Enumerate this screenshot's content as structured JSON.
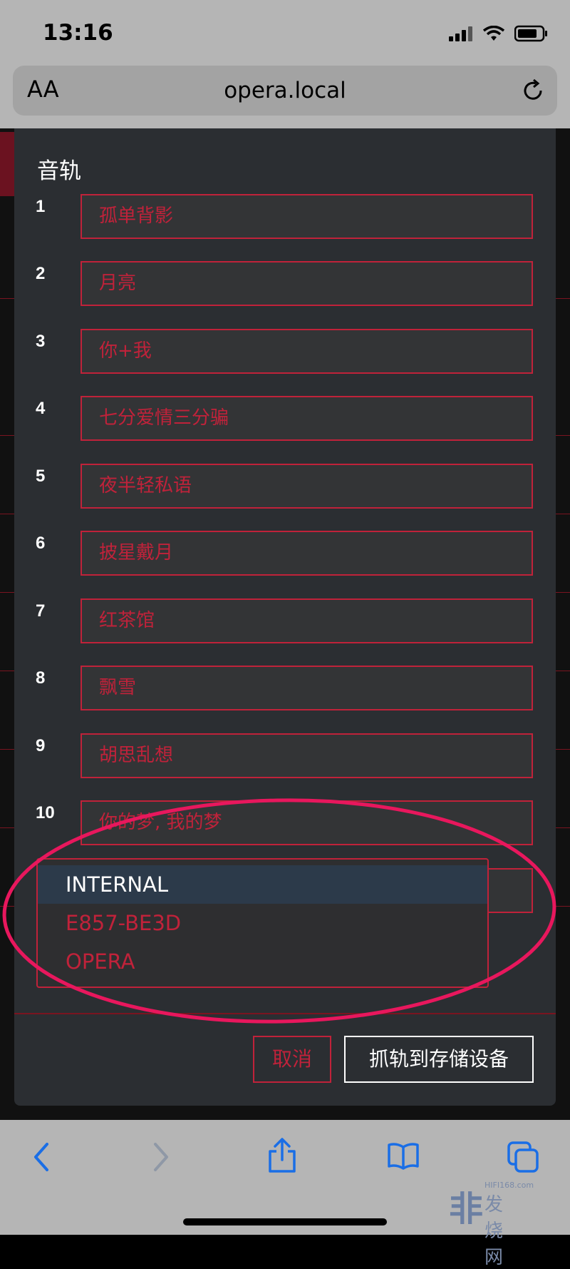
{
  "status_bar": {
    "time": "13:16"
  },
  "browser": {
    "text_size_label": "AA",
    "url": "opera.local"
  },
  "modal": {
    "title": "音轨",
    "tracks": [
      {
        "number": "1",
        "title": "孤单背影"
      },
      {
        "number": "2",
        "title": "月亮"
      },
      {
        "number": "3",
        "title": "你+我"
      },
      {
        "number": "4",
        "title": "七分爱情三分骗"
      },
      {
        "number": "5",
        "title": "夜半轻私语"
      },
      {
        "number": "6",
        "title": "披星戴月"
      },
      {
        "number": "7",
        "title": "红茶馆"
      },
      {
        "number": "8",
        "title": "飘雪"
      },
      {
        "number": "9",
        "title": "胡思乱想"
      },
      {
        "number": "10",
        "title": "你的梦, 我的梦"
      }
    ],
    "storage_dropdown": {
      "options": [
        "INTERNAL",
        "E857-BE3D",
        "OPERA"
      ],
      "selected": "INTERNAL"
    },
    "cancel_label": "取消",
    "rip_label": "抓轨到存储设备"
  },
  "watermark": {
    "site": "HIFI168.com",
    "text": "发烧网"
  },
  "colors": {
    "accent": "#c0223a",
    "modal_bg": "#2b2e32",
    "highlight": "#e8175d",
    "chrome": "#b5b5b5",
    "ios_blue": "#1a6ee6"
  }
}
